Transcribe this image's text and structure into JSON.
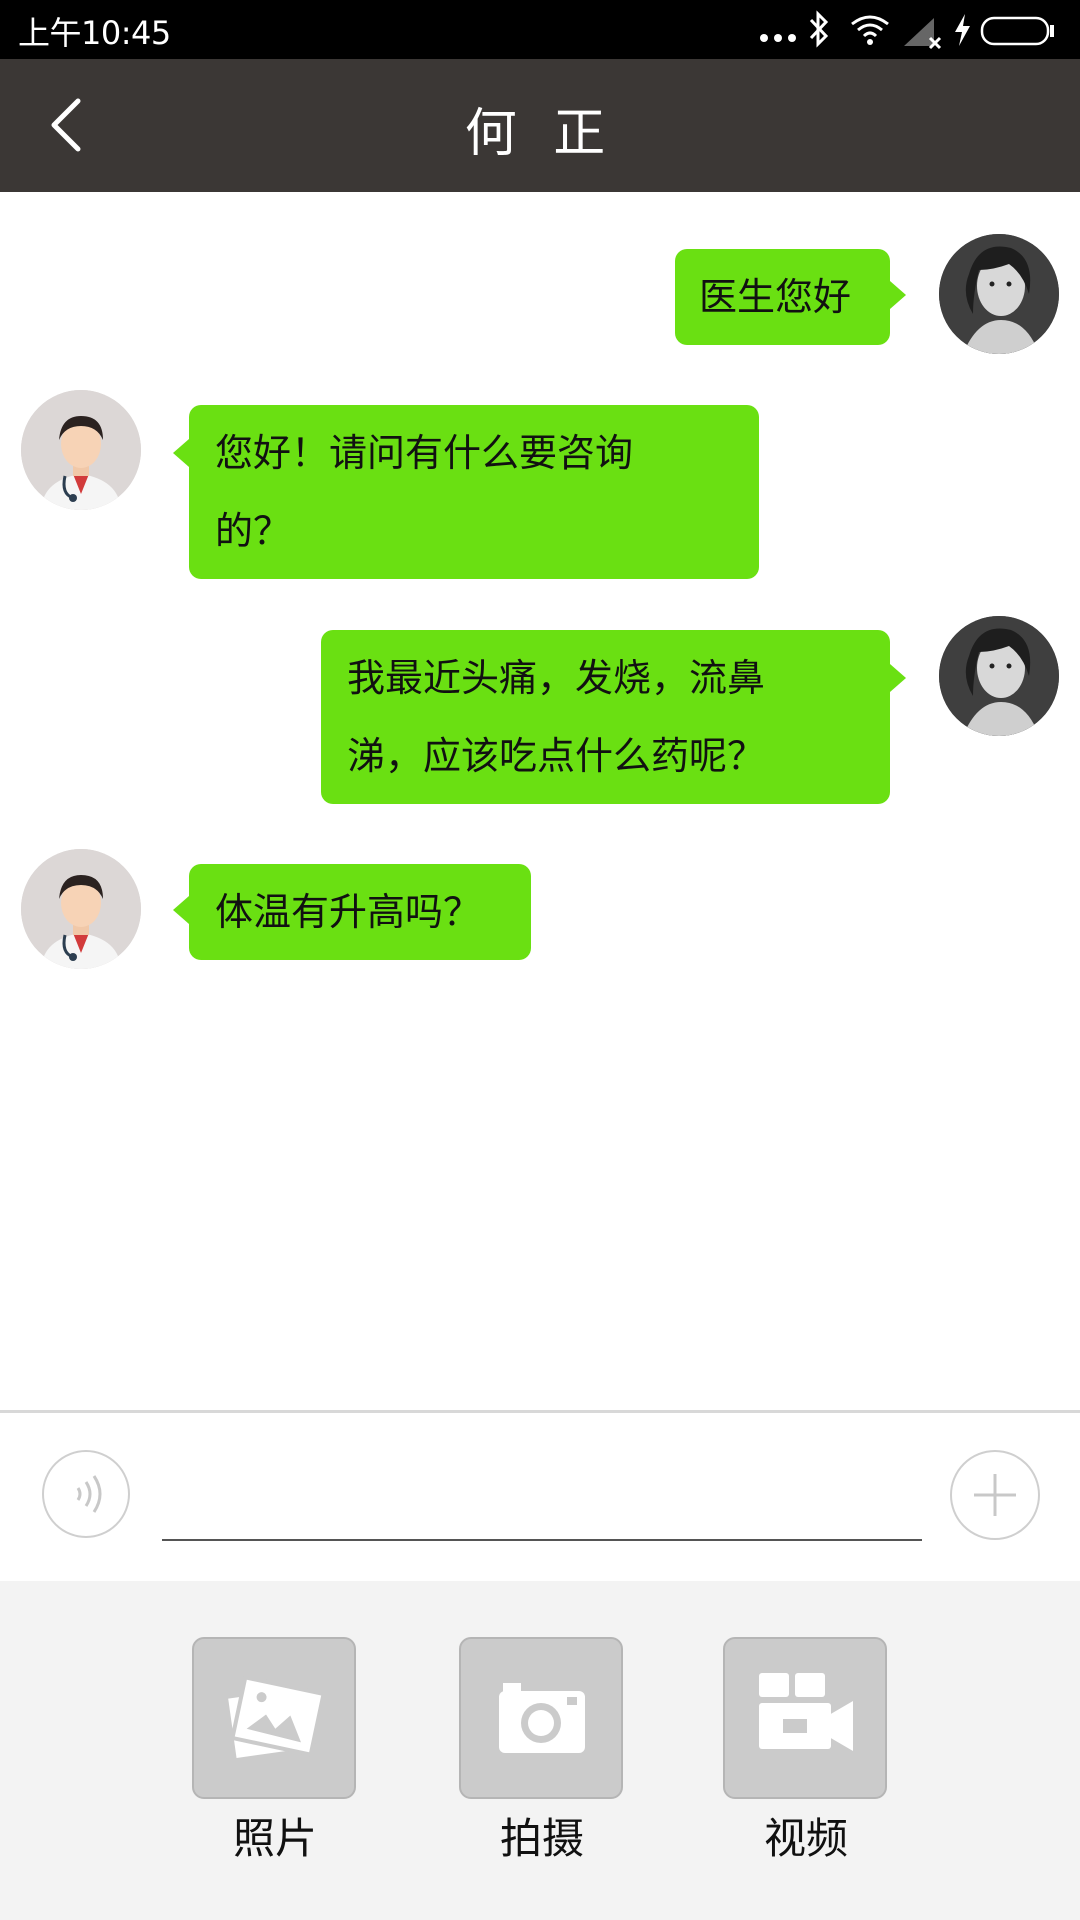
{
  "status_bar": {
    "time": "上午10:45"
  },
  "header": {
    "title": "何 正"
  },
  "messages": [
    {
      "side": "right",
      "text": "医生您好"
    },
    {
      "side": "left",
      "lines": [
        "您好！请问有什么要咨询",
        "的？"
      ]
    },
    {
      "side": "right",
      "lines": [
        "我最近头痛，发烧，流鼻",
        "涕，应该吃点什么药呢？"
      ]
    },
    {
      "side": "left",
      "text": "体温有升高吗？"
    }
  ],
  "input": {
    "value": "",
    "placeholder": ""
  },
  "tools": [
    {
      "label": "照片",
      "icon": "photo-icon"
    },
    {
      "label": "拍摄",
      "icon": "camera-icon"
    },
    {
      "label": "视频",
      "icon": "video-icon"
    }
  ],
  "colors": {
    "bubble": "#6ae012",
    "header": "#3b3735",
    "status_bar": "#000000"
  }
}
